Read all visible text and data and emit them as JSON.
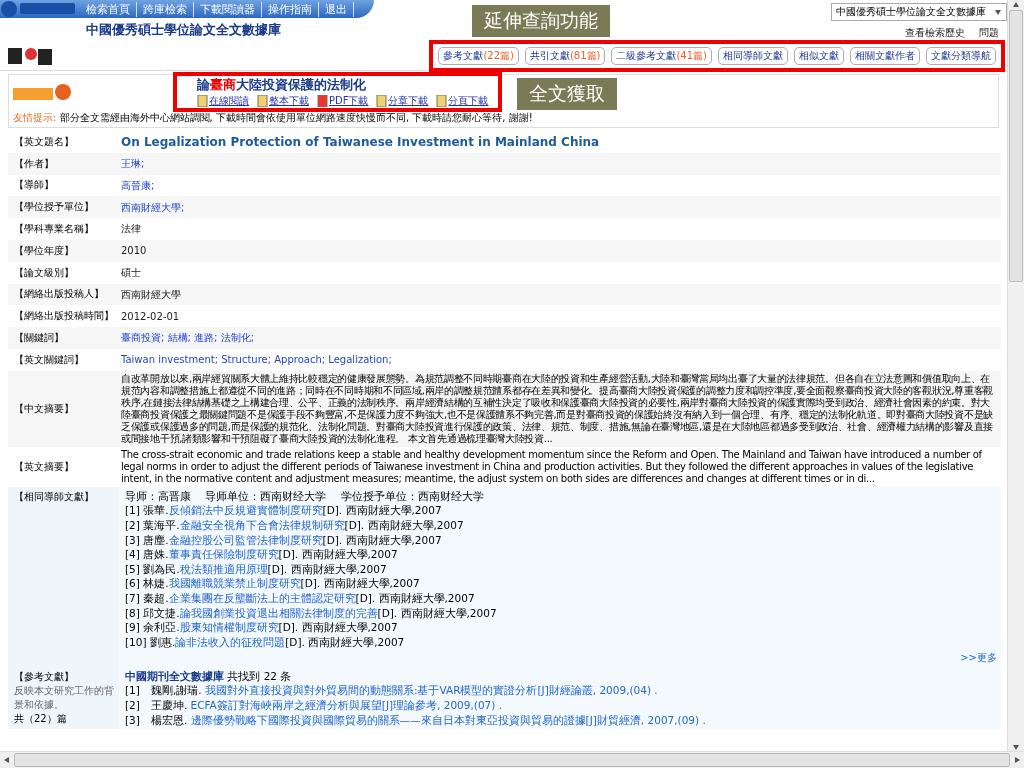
{
  "top_nav": {
    "links": [
      "檢索首頁",
      "跨庫檢索",
      "下載閱讀器",
      "操作指南",
      "退出"
    ],
    "database_select": "中國優秀碩士學位論文全文數據庫",
    "db_title": "中國優秀碩士學位論文全文數據庫",
    "history_link": "查看檢索歷史",
    "help_link": "問題"
  },
  "annotations": [
    {
      "text": "延伸查詢功能"
    },
    {
      "text": "全文獲取"
    }
  ],
  "extension_tabs": [
    {
      "label": "參考文獻",
      "count": "(22篇)"
    },
    {
      "label": "共引文獻",
      "count": "(81篇)"
    },
    {
      "label": "二級參考文獻",
      "count": "(41篇)"
    },
    {
      "label": "相同導師文獻"
    },
    {
      "label": "相似文獻"
    },
    {
      "label": "相關文獻作者"
    },
    {
      "label": "文獻分類導航"
    }
  ],
  "article": {
    "title_before": "論",
    "title_highlight": "臺商",
    "title_after": "大陸投資保護的法制化",
    "downloads": [
      "在線閱讀",
      "整本下載",
      "PDF下載",
      "分章下載",
      "分頁下載"
    ],
    "tip_label": "友情提示:",
    "tip": "部分全文需經由海外中心網站調閱, 下載時間會依使用單位網路速度快慢而不同, 下載時請您耐心等待, 謝謝!"
  },
  "fields": [
    {
      "label": "【英文題名】",
      "kind": "title",
      "value": "On Legalization Protection of Taiwanese Investment in Mainland China"
    },
    {
      "label": "【作者】",
      "kind": "link",
      "value": "王琳;"
    },
    {
      "label": "【導師】",
      "kind": "link",
      "value": "高晉康;"
    },
    {
      "label": "【學位授予單位】",
      "kind": "link",
      "value": "西南財經大學;"
    },
    {
      "label": "【學科專業名稱】",
      "kind": "text",
      "value": "法律"
    },
    {
      "label": "【學位年度】",
      "kind": "text",
      "value": "2010"
    },
    {
      "label": "【論文級別】",
      "kind": "text",
      "value": "碩士"
    },
    {
      "label": "【網絡出版投稿人】",
      "kind": "text",
      "value": "西南財經大學"
    },
    {
      "label": "【網絡出版投稿時間】",
      "kind": "text",
      "value": "2012-02-01"
    },
    {
      "label": "【關鍵詞】",
      "kind": "link",
      "value": "臺商投資; 結構; 進路; 法制化;"
    },
    {
      "label": "【英文關鍵詞】",
      "kind": "link",
      "value": "Taiwan investment; Structure; Approach; Legalization;"
    },
    {
      "label": "【中文摘要】",
      "kind": "abstract",
      "value": "自改革開放以來,兩岸經貿關系大體上維持比較穩定的健康發展態勢。為規范調整不同時期臺商在大陸的投資和生產經營活動,大陸和臺灣當局均出臺了大量的法律規范。但各自在立法意圖和價值取向上、在規范內容和調整措施上都遵從不同的進路；同時在不同時期和不同區域,兩岸的調整規范體系都存在差異和變化。提高臺商大陸投資保護的調整力度和調控準度,要全面觀察臺商投資大陸的客觀狀況,尊重客觀秩序,在鏈接法律結構基礎之上構建合理、公平、正義的法制秩序。兩岸經濟結構的互補性決定了吸收和保護臺商大陸投資的必要性,兩岸對臺商大陸投資的保護實際均受到政治、經濟社會因素的約束。對大陸臺商投資保護之最關鍵問題不是保護手段不夠豐富,不是保護力度不夠強大,也不是保護體系不夠完善,而是對臺商投資的保護始終沒有納入到一個合理、有序、穩定的法制化軌道。即對臺商大陸投資不是缺乏保護或保護過多的問題,而是保護的規范化、法制化問題。對臺商大陸投資進行保護的政策、法律、規范、制度、措施,無論在臺灣地區,還是在大陸地區都過多受到政治、社會、經濟權力結構的影響及直接或間接地干預,諸類影響和干預阻礙了臺商大陸投資的法制化進程。 本文首先通過梳理臺灣大陸投資..."
    },
    {
      "label": "【英文摘要】",
      "kind": "abstract",
      "value": "The cross-strait economic and trade relations keep a stable and healthy development momentum since the Reform and Open. The Mainland and Taiwan have introduced a number of legal norms in order to adjust the different periods of Taiwanese investment in China and production activities. But they followed the different approaches in values of the legislative intent, in the normative content and adjustment measures; meantime, the adjust system on both sides are differences and changes at different times or in di..."
    }
  ],
  "same_supervisor": {
    "label": "【相同導師文獻】",
    "header": "导师：高晋康　 导师单位：西南财经大学　 学位授予单位：西南财经大学",
    "items": [
      {
        "num": "[1]",
        "author": "張華.",
        "title": "反傾銷法中反規避實體制度研究",
        "tail": "[D]. 西南財經大學,2007"
      },
      {
        "num": "[2]",
        "author": "葉海平.",
        "title": "金融安全視角下合會法律規制研究",
        "tail": "[D]. 西南財經大學,2007"
      },
      {
        "num": "[3]",
        "author": "唐塵.",
        "title": "金融控股公司監管法律制度研究",
        "tail": "[D]. 西南財經大學,2007"
      },
      {
        "num": "[4]",
        "author": "唐姝.",
        "title": "董事責任保險制度研究",
        "tail": "[D]. 西南財經大學,2007"
      },
      {
        "num": "[5]",
        "author": "劉為民.",
        "title": "稅法類推適用原理",
        "tail": "[D]. 西南財經大學,2007"
      },
      {
        "num": "[6]",
        "author": "林婕.",
        "title": "我國離職競業禁止制度研究",
        "tail": "[D]. 西南財經大學,2007"
      },
      {
        "num": "[7]",
        "author": "秦超.",
        "title": "企業集團在反壟斷法上的主體認定研究",
        "tail": "[D]. 西南財經大學,2007"
      },
      {
        "num": "[8]",
        "author": "邱文捷.",
        "title": "論我國創業投資退出相關法律制度的完善",
        "tail": "[D]. 西南財經大學,2007"
      },
      {
        "num": "[9]",
        "author": "余利亞.",
        "title": "股東知情權制度研究",
        "tail": "[D]. 西南財經大學,2007"
      },
      {
        "num": "[10]",
        "author": "劉惠.",
        "title": "論非法收入的征稅問題",
        "tail": "[D]. 西南財經大學,2007"
      }
    ],
    "more": ">>更多"
  },
  "references": {
    "label": "【參考文獻】",
    "desc": "反映本文研究工作的背景和依據。",
    "total": "共（22）篇",
    "db": "中國期刊全文數據庫",
    "found": "共找到 22 条",
    "items": [
      {
        "num": "[1]",
        "author": "魏剛,謝瑞.",
        "title": "我國對外直接投資與對外貿易間的動態關系:基于VAR模型的實證分析[J]財經論叢",
        "tail": ", 2009,(04) ."
      },
      {
        "num": "[2]",
        "author": "王慶坤.",
        "title": "ECFA簽訂對海峽兩岸之經濟分析與展望[J]理論參考",
        "tail": ", 2009,(07) ."
      },
      {
        "num": "[3]",
        "author": "楊宏恩.",
        "title": "邊際優勢戰略下國際投資與國際貿易的關系——來自日本對東亞投資與貿易的證據[J]財貿經濟",
        "tail": ", 2007,(09) ."
      }
    ]
  }
}
